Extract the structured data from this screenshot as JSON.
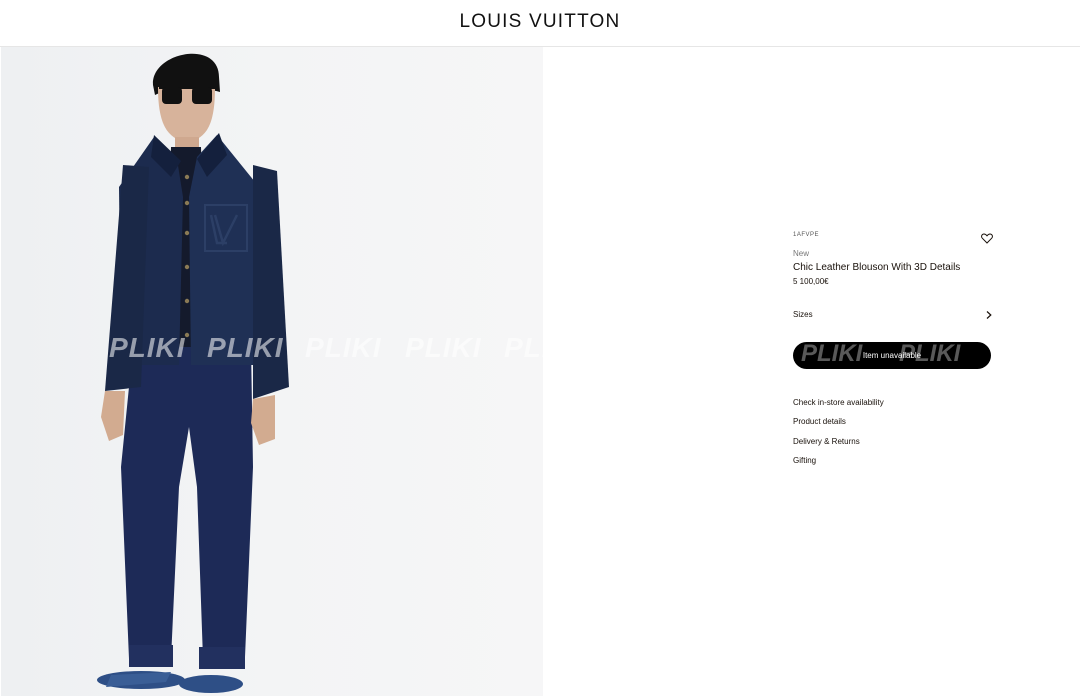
{
  "header": {
    "brand": "LOUIS VUITTON"
  },
  "photo": {
    "watermark": "PLIKI"
  },
  "product": {
    "sku": "1AFVPE",
    "tag": "New",
    "name": "Chic Leather Blouson With 3D Details",
    "price": "5 100,00€",
    "sizes_label": "Sizes",
    "cta_label": "Item unavailable",
    "cta_watermark": "PLIKI"
  },
  "links": [
    "Check in-store availability",
    "Product details",
    "Delivery & Returns",
    "Gifting"
  ],
  "icons": {
    "wishlist": "heart-icon",
    "sizes": "chevron-right-icon"
  },
  "colors": {
    "jacket": "#1c2b4e",
    "trousers": "#1d2a57",
    "button": "#000000"
  }
}
